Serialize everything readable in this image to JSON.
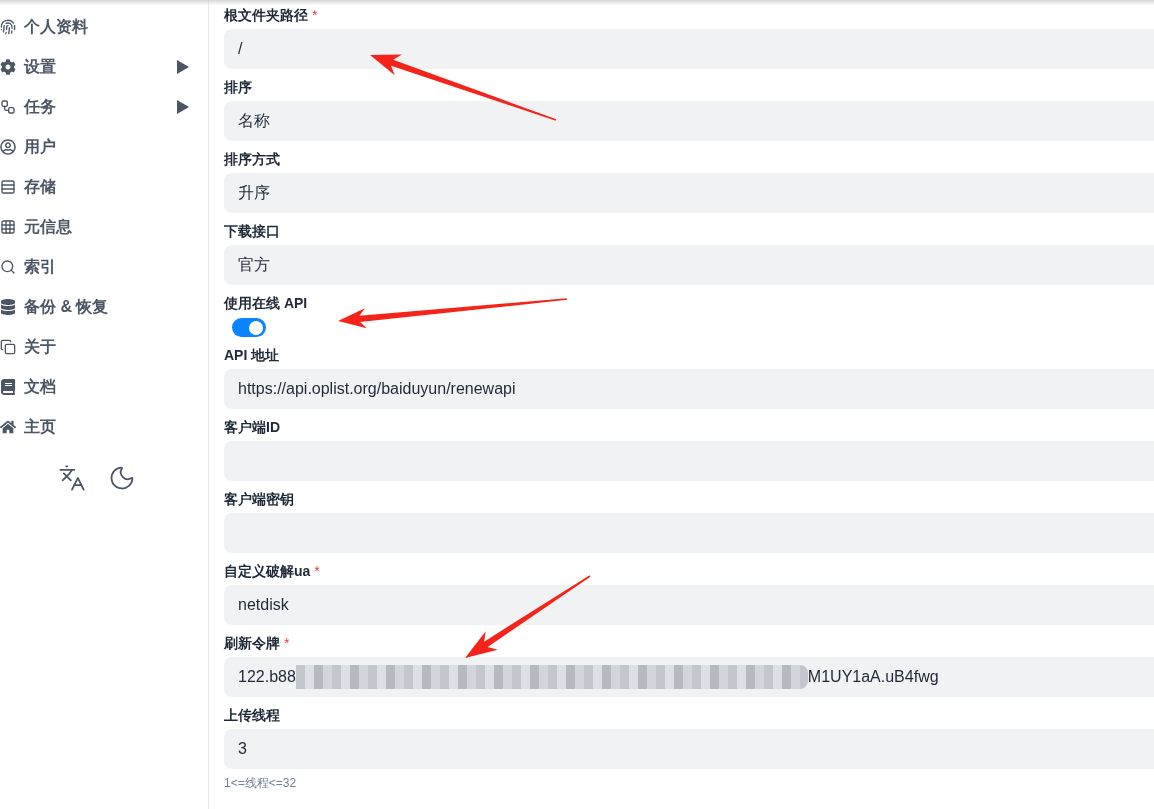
{
  "sidebar": {
    "items": [
      {
        "kind": "link",
        "label": "个人资料"
      },
      {
        "kind": "group",
        "label": "设置",
        "expanded": false
      },
      {
        "kind": "group",
        "label": "任务",
        "expanded": false
      },
      {
        "kind": "link",
        "label": "用户"
      },
      {
        "kind": "link",
        "label": "存储"
      },
      {
        "kind": "link",
        "label": "元信息"
      },
      {
        "kind": "link",
        "label": "索引"
      },
      {
        "kind": "link",
        "label": "备份 & 恢复"
      },
      {
        "kind": "link",
        "label": "关于"
      },
      {
        "kind": "link",
        "label": "文档"
      },
      {
        "kind": "link",
        "label": "主页"
      }
    ]
  },
  "form": {
    "fields": [
      {
        "kind": "text",
        "label": "根文件夹路径",
        "required_mark": "*",
        "value": "/"
      },
      {
        "kind": "text",
        "label": "排序",
        "value": "名称"
      },
      {
        "kind": "text",
        "label": "排序方式",
        "value": "升序"
      },
      {
        "kind": "text",
        "label": "下载接口",
        "value": "官方"
      },
      {
        "kind": "switch",
        "label": "使用在线 API",
        "on": true
      },
      {
        "kind": "text",
        "label": "API 地址",
        "value": "https://api.oplist.org/baiduyun/renewapi"
      },
      {
        "kind": "text",
        "label": "客户端ID"
      },
      {
        "kind": "text",
        "label": "客户端密钥"
      },
      {
        "kind": "text",
        "label": "自定义破解ua",
        "required_mark": "*",
        "value": "netdisk"
      },
      {
        "kind": "redacted",
        "label": "刷新令牌",
        "required_mark": "*",
        "value_start": "122.b88",
        "value_end": "M1UY1aA.uB4fwg"
      },
      {
        "kind": "text",
        "label": "上传线程",
        "value": "3",
        "help": "1<=线程<=32"
      }
    ]
  },
  "annotations": [
    {
      "kind": "arrow"
    },
    {
      "kind": "arrow"
    },
    {
      "kind": "arrow"
    }
  ]
}
